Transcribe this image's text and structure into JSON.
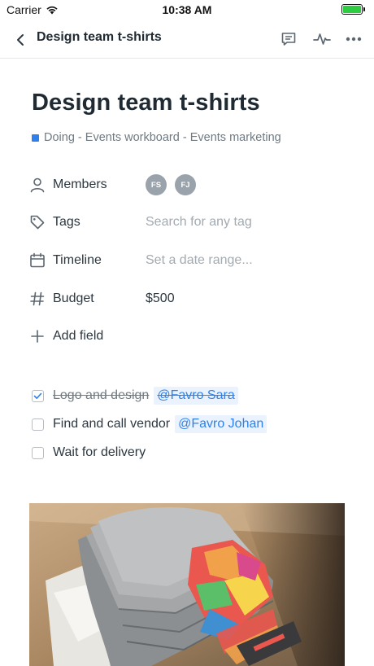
{
  "status_bar": {
    "carrier": "Carrier",
    "time": "10:38 AM",
    "battery_level": 1.0
  },
  "nav": {
    "title": "Design team t-shirts",
    "icons": [
      "back-chevron-icon",
      "comment-icon",
      "activity-icon",
      "more-icon"
    ]
  },
  "card": {
    "title": "Design team t-shirts",
    "breadcrumb": "Doing - Events workboard - Events marketing",
    "breadcrumb_color": "#2f80ed"
  },
  "fields": {
    "members": {
      "label": "Members",
      "avatars": [
        "FS",
        "FJ"
      ]
    },
    "tags": {
      "label": "Tags",
      "placeholder": "Search for any tag"
    },
    "timeline": {
      "label": "Timeline",
      "placeholder": "Set a date range..."
    },
    "budget": {
      "label": "Budget",
      "value": "$500"
    },
    "add_field": {
      "label": "Add field"
    }
  },
  "checklist": [
    {
      "text": "Logo and design",
      "mention": "@Favro Sara",
      "checked": true
    },
    {
      "text": "Find and call vendor",
      "mention": "@Favro Johan",
      "checked": false
    },
    {
      "text": "Wait for delivery",
      "mention": "",
      "checked": false
    }
  ],
  "attachment": {
    "description_icon": "photo-stack-of-tshirts"
  }
}
